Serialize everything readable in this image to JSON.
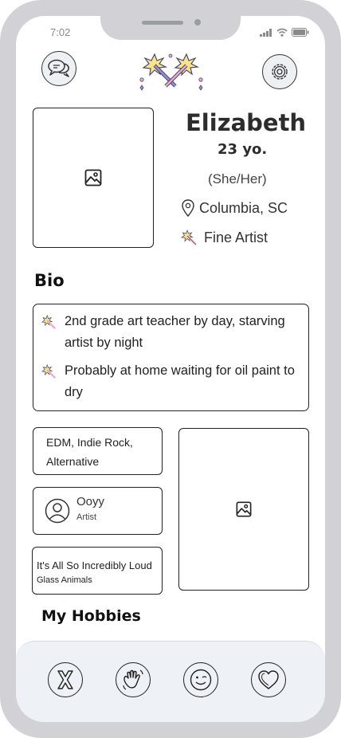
{
  "status_bar": {
    "time": "7:02"
  },
  "profile": {
    "name": "Elizabeth",
    "age": "23 yo.",
    "pronouns": "(She/Her)",
    "location": "Columbia, SC",
    "occupation": "Fine Artist"
  },
  "bio": {
    "title": "Bio",
    "items": [
      "2nd grade art teacher by day, starving artist by night",
      "Probably at home waiting for oil paint to dry"
    ]
  },
  "music": {
    "genres": "EDM, Indie Rock, Alternative",
    "artist_name": "Ooyy",
    "artist_label": "Artist",
    "song_title": "It's All So Incredibly Loud",
    "song_artist": "Glass Animals"
  },
  "hobbies": {
    "title": "My Hobbies"
  },
  "icons": {
    "messages": "chat-bubbles-icon",
    "settings": "gear-icon",
    "logo": "sparklers-icon",
    "photo_placeholder": "image-icon",
    "location": "map-pin-icon",
    "occupation": "sparkler-icon",
    "actions": [
      "x-icon",
      "wave-hand-icon",
      "wink-face-icon",
      "heart-icon"
    ]
  },
  "colors": {
    "frame": "#d2d1d6",
    "sparkle_yellow": "#f6e58d",
    "sparkle_pink": "#f2a7c7",
    "sparkle_purple": "#9b8cd9",
    "bottom_bar": "#eef1f5"
  }
}
